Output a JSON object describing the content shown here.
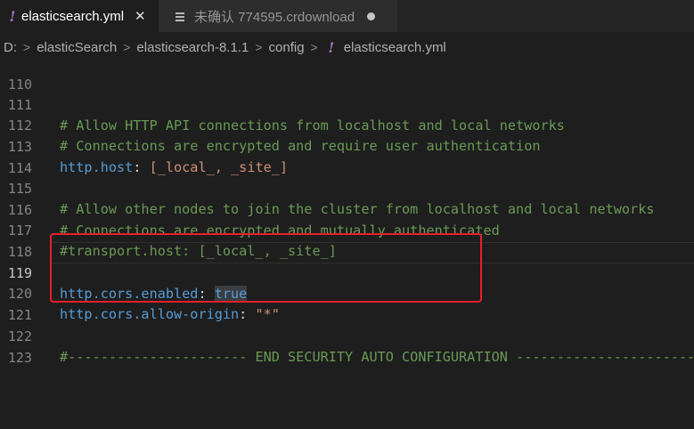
{
  "tabs": [
    {
      "label": "elasticsearch.yml",
      "icon": "yaml-icon",
      "active": true
    },
    {
      "label": "未确认 774595.crdownload",
      "icon": "file-lines-icon",
      "active": false
    }
  ],
  "breadcrumb": {
    "items": [
      "D:",
      "elasticSearch",
      "elasticsearch-8.1.1",
      "config",
      "elasticsearch.yml"
    ]
  },
  "editor": {
    "current_line": "119",
    "lines": [
      {
        "n": "110",
        "comment": ""
      },
      {
        "n": "111",
        "comment": "# Allow HTTP API connections from localhost and local networks"
      },
      {
        "n": "112",
        "comment": "# Connections are encrypted and require user authentication"
      },
      {
        "n": "113",
        "key": "http.host",
        "sep": ": ",
        "value": "[_local_, _site_]"
      },
      {
        "n": "114"
      },
      {
        "n": "115",
        "comment": "# Allow other nodes to join the cluster from localhost and local networks"
      },
      {
        "n": "116",
        "comment": "# Connections are encrypted and mutually authenticated"
      },
      {
        "n": "117",
        "comment": "#transport.host: [_local_, _site_]"
      },
      {
        "n": "118"
      },
      {
        "n": "119",
        "key": "http.cors.enabled",
        "sep": ": ",
        "value": "true"
      },
      {
        "n": "120",
        "key": "http.cors.allow-origin",
        "sep": ": ",
        "value": "\"*\""
      },
      {
        "n": "121"
      },
      {
        "n": "122",
        "comment": "#---------------------- END SECURITY AUTO CONFIGURATION -------------------------"
      },
      {
        "n": "123"
      }
    ]
  },
  "colors": {
    "comment": "#6a9955",
    "key": "#569cd6",
    "string": "#ce9178",
    "highlight_box": "#e8202a"
  }
}
